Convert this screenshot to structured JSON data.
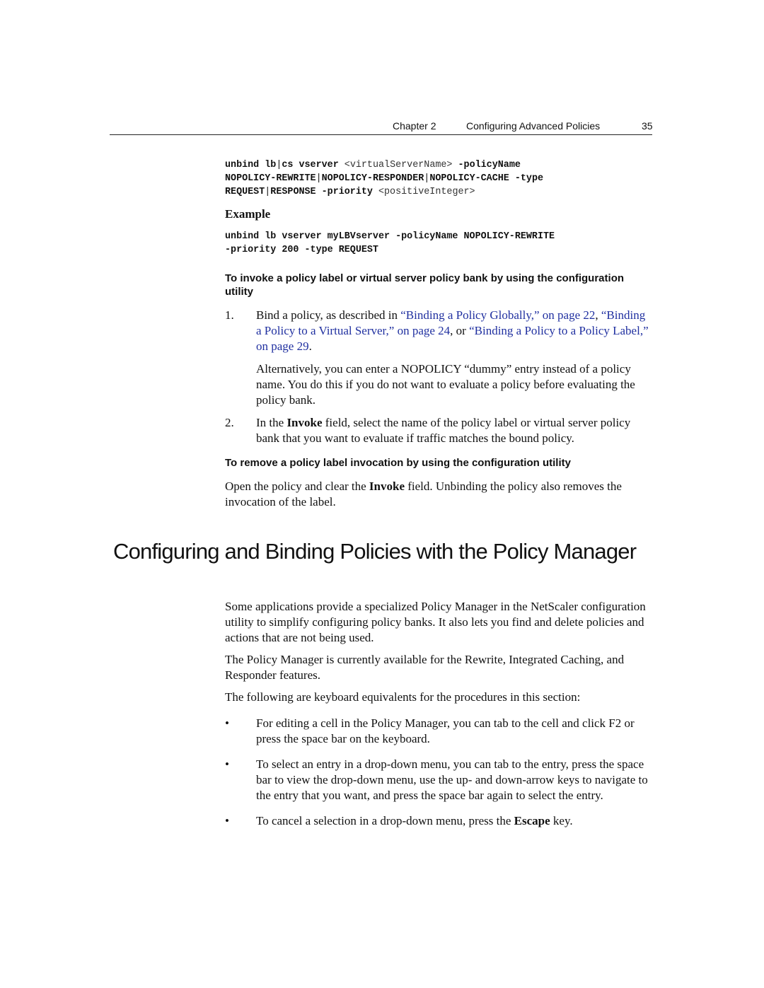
{
  "header": {
    "chapter": "Chapter 2",
    "title": "Configuring Advanced Policies",
    "page_number": "35"
  },
  "syntax": {
    "line1_cmd": "unbind lb",
    "line1_sep": "|",
    "line1_cmd2": "cs vserver ",
    "line1_arg": "<virtualServerName>",
    "line1_opt": " -policyName",
    "line2_a": "NOPOLICY-REWRITE",
    "line2_b": "NOPOLICY-RESPONDER",
    "line2_c": "NOPOLICY-CACHE -type",
    "line3_a": "REQUEST",
    "line3_b": "RESPONSE -priority ",
    "line3_arg": "<positiveInteger>"
  },
  "example": {
    "heading": "Example",
    "code_line1": "unbind lb vserver myLBVserver -policyName NOPOLICY-REWRITE",
    "code_line2": "-priority 200 -type REQUEST"
  },
  "procedure1": {
    "heading": "To invoke a policy label or virtual server policy bank by using the configuration utility",
    "step1": {
      "num": "1.",
      "text_a": "Bind a policy, as described in ",
      "link1": "“Binding a Policy Globally,” on page 22",
      "text_b": ", ",
      "link2": "“Binding a Policy to a Virtual Server,” on page 24",
      "text_c": ", or ",
      "link3": "“Binding a Policy to a Policy Label,” on page 29",
      "text_d": ".",
      "note": "Alternatively, you can enter a NOPOLICY “dummy” entry instead of a policy name. You do this if you do not want to evaluate a policy before evaluating the policy bank."
    },
    "step2": {
      "num": "2.",
      "text_a": "In the ",
      "bold": "Invoke",
      "text_b": " field, select the name of the policy label or virtual server policy bank that you want to evaluate if traffic matches the bound policy."
    }
  },
  "procedure2": {
    "heading": "To remove a policy label invocation by using the configuration utility",
    "text_a": "Open the policy and clear the ",
    "bold": "Invoke",
    "text_b": " field. Unbinding the policy also removes the invocation of the label."
  },
  "section": {
    "heading": "Configuring and Binding Policies with the Policy Manager",
    "para1": "Some applications provide a specialized Policy Manager in the NetScaler configuration utility to simplify configuring policy banks. It also lets you find and delete policies and actions that are not being used.",
    "para2": "The Policy Manager is currently available for the Rewrite, Integrated Caching, and Responder features.",
    "para3": "The following are keyboard equivalents for the procedures in this section:",
    "bullets": [
      {
        "symbol": "•",
        "text": "For editing a cell in the Policy Manager, you can tab to the cell and click F2 or press the space bar on the keyboard."
      },
      {
        "symbol": "•",
        "text": "To select an entry in a drop-down menu, you can tab to the entry, press the space bar to view the drop-down menu, use the up- and down-arrow keys to navigate to the entry that you want, and press the space bar again to select the entry."
      },
      {
        "symbol": "•",
        "text_a": "To cancel a selection in a drop-down menu, press the ",
        "bold": "Escape",
        "text_b": " key."
      }
    ]
  },
  "colors": {
    "link": "#2030a0",
    "text": "#111111"
  }
}
